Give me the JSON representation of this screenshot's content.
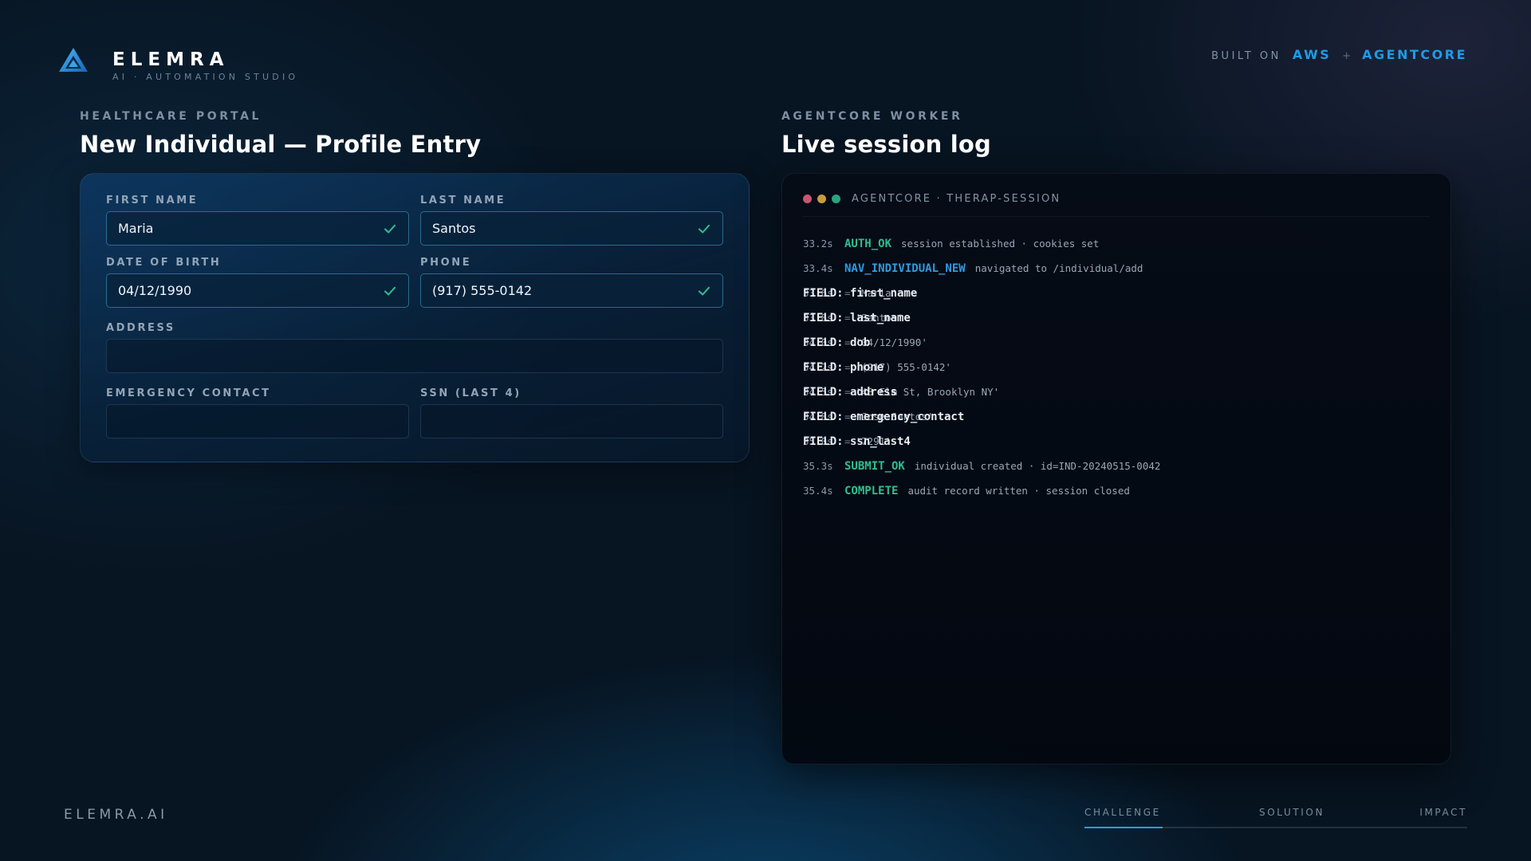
{
  "header": {
    "brand_name": "ELEMRA",
    "brand_tagline": "AI · AUTOMATION STUDIO",
    "logo_icon": "elemra-triangle-logo-icon",
    "built_on_label": "BUILT ON",
    "built_on_primary": "AWS",
    "built_on_separator": "+",
    "built_on_secondary": "AGENTCORE"
  },
  "portal": {
    "eyebrow": "HEALTHCARE PORTAL",
    "title": "New Individual — Profile Entry",
    "fields": {
      "first_name": {
        "label": "FIRST NAME",
        "value": "Maria",
        "validated": true
      },
      "last_name": {
        "label": "LAST NAME",
        "value": "Santos",
        "validated": true
      },
      "dob": {
        "label": "DATE OF BIRTH",
        "value": "04/12/1990",
        "validated": true
      },
      "phone": {
        "label": "PHONE",
        "value": "(917) 555-0142",
        "validated": true
      },
      "address": {
        "label": "ADDRESS",
        "value": "",
        "validated": false
      },
      "emergency_contact": {
        "label": "EMERGENCY CONTACT",
        "value": "",
        "validated": false
      },
      "ssn_last4": {
        "label": "SSN (LAST 4)",
        "value": "",
        "validated": false
      }
    }
  },
  "worker": {
    "eyebrow": "AGENTCORE WORKER",
    "title": "Live session log",
    "console_title": "AGENTCORE · THERAP-SESSION",
    "log": [
      {
        "time": "33.2s",
        "tag": "AUTH_OK",
        "kind": "ok",
        "message": "session established · cookies set"
      },
      {
        "time": "33.4s",
        "tag": "NAV_INDIVIDUAL_NEW",
        "kind": "nav",
        "message": "navigated to /individual/add"
      },
      {
        "time": "33.6s",
        "tag": "FIELD: first_name",
        "kind": "field",
        "eq": "=",
        "message": "'Maria'"
      },
      {
        "time": "33.8s",
        "tag": "FIELD: last_name",
        "kind": "field",
        "eq": "=",
        "message": "'Santos'"
      },
      {
        "time": "34.0s",
        "tag": "FIELD: dob",
        "kind": "field",
        "eq": "=",
        "message": "'04/12/1990'"
      },
      {
        "time": "34.2s",
        "tag": "FIELD: phone",
        "kind": "field",
        "eq": "=",
        "message": "'(917) 555-0142'"
      },
      {
        "time": "34.5s",
        "tag": "FIELD: address",
        "kind": "field",
        "eq": "=",
        "message": "'48 Elm St, Brooklyn NY'"
      },
      {
        "time": "34.8s",
        "tag": "FIELD: emergency_contact",
        "kind": "field",
        "eq": "=",
        "message": "'Jose Santos'"
      },
      {
        "time": "35.0s",
        "tag": "FIELD: ssn_last4",
        "kind": "field",
        "eq": "=",
        "message": "'7291'"
      },
      {
        "time": "35.3s",
        "tag": "SUBMIT_OK",
        "kind": "ok",
        "message": "individual created · id=IND-20240515-0042"
      },
      {
        "time": "35.4s",
        "tag": "COMPLETE",
        "kind": "ok",
        "message": "audit record written · session closed"
      }
    ]
  },
  "footer": {
    "brand": "ELEMRA.AI",
    "steps": [
      "CHALLENGE",
      "SOLUTION",
      "IMPACT"
    ],
    "active_step": "SOLUTION",
    "progress_fraction": 0.5
  },
  "colors": {
    "accent": "#2f9be0",
    "success": "#2fbf8f",
    "background": "#071421"
  }
}
